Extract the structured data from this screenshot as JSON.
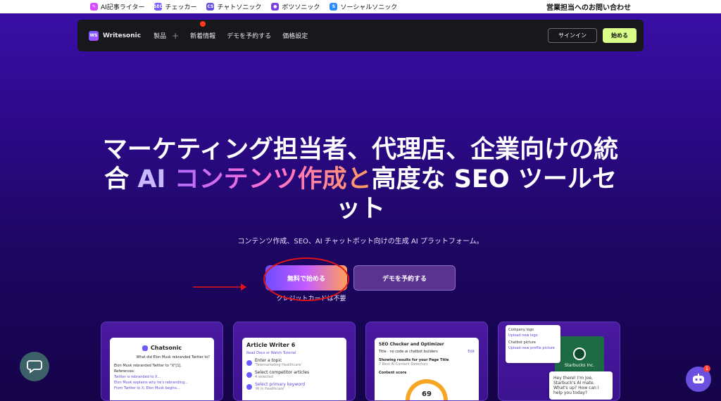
{
  "topbar": {
    "links": [
      {
        "label": "AI記事ライター",
        "icon": "article-writer-icon",
        "color": "#d64cff",
        "glyph": "✎"
      },
      {
        "label": "チェッカー",
        "icon": "seo-icon",
        "color": "#7b5cff",
        "glyph": "SEO"
      },
      {
        "label": "チャトソニック",
        "icon": "chatsonic-icon",
        "color": "#6a4fe0",
        "glyph": "CS"
      },
      {
        "label": "ボツソニック",
        "icon": "botsonic-icon",
        "color": "#7b3fe4",
        "glyph": "●"
      },
      {
        "label": "ソーシャルソニック",
        "icon": "socialsonic-icon",
        "color": "#2c8cff",
        "glyph": "S"
      }
    ],
    "contact": "営業担当へのお問い合わせ"
  },
  "nav": {
    "logo_mark": "WS",
    "logo_text": "Writesonic",
    "items": [
      "製品",
      "新着情報",
      "デモを予約する",
      "価格設定"
    ],
    "plus": "+",
    "signin": "サインイン",
    "start": "始める"
  },
  "hero": {
    "headline_part1": "マーケティング担当者、代理店、企業向けの統合 ",
    "headline_ai": "AI ",
    "headline_grad": "コンテンツ作成と",
    "headline_part2": "高度な SEO ツールセット",
    "subhead": "コンテンツ作成、SEO、AI チャットボット向けの生成 AI プラットフォーム。",
    "cta_free": "無料で始める",
    "cta_demo": "デモを予約する",
    "no_cc": "クレジットカードは不要"
  },
  "cards": {
    "chatsonic": {
      "title": "Chatsonic",
      "question": "What did Elon Musk rebranded Twitter to?",
      "answer": "Elon Musk rebranded Twitter to \"X\"[1].",
      "refs_label": "References:",
      "refs": [
        "Twitter is rebranded to X...",
        "Elon Musk explains why he's rebranding...",
        "From Twitter to X: Elon Musk begins..."
      ]
    },
    "article_writer": {
      "title": "Article Writer 6",
      "links": "Read Docs or Watch Tutorial",
      "steps": [
        {
          "label": "Enter a topic",
          "sub": "'Telemarketing Healthcare'"
        },
        {
          "label": "Select competitor articles",
          "sub": "4 selected"
        },
        {
          "label": "Select primary keyword",
          "sub": "'AI in Healthcare'"
        }
      ]
    },
    "seo_checker": {
      "title": "SEO Checker and Optimizer",
      "meta": "Title · no code ai chatbot builders",
      "edit": "Edit",
      "results_label": "Showing results for your Page Title",
      "results_sub": "7 Best AI Content Detectors",
      "score_label": "Content score",
      "score": "69"
    },
    "botsonic": {
      "company_logo": "Company logo",
      "upload_logo": "Upload new logo",
      "chatbot_picture": "Chatbot picture",
      "upload_picture": "Upload new profile picture",
      "brand": "Starbucks Inc.",
      "greeting": "Hey there! I'm Joe, Starbuck's AI mate. What's up? How can I help you today?"
    }
  },
  "widgets": {
    "chat_icon": "chat-bubble-icon",
    "bot_icon": "bot-icon",
    "bot_badge": "1"
  },
  "annotation": {
    "color": "#e41414"
  }
}
